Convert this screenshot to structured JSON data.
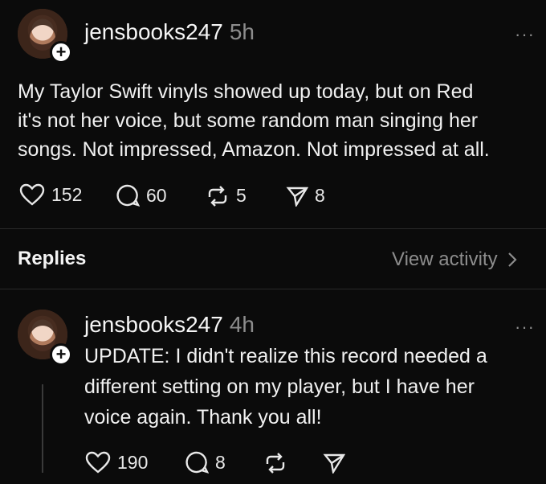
{
  "post": {
    "username": "jensbooks247",
    "time": "5h",
    "more": "···",
    "text_lines": [
      "My Taylor Swift vinyls showed up today, but on Red",
      "it's not her voice, but some random man singing her",
      "songs. Not impressed, Amazon. Not impressed at all."
    ],
    "likes": "152",
    "comments": "60",
    "reposts": "5",
    "shares": "8"
  },
  "replies_section": {
    "title": "Replies",
    "view_activity": "View activity"
  },
  "reply": {
    "username": "jensbooks247",
    "time": "4h",
    "more": "···",
    "text_lines": [
      "UPDATE: I didn't realize this record needed a",
      "different setting on my player, but I have her",
      "voice again. Thank you all!"
    ],
    "likes": "190",
    "comments": "8"
  },
  "icons": {
    "like": "heart-icon",
    "comment": "comment-icon",
    "repost": "repost-icon",
    "share": "send-icon",
    "follow": "plus-icon",
    "chevron": "chevron-right-icon"
  }
}
